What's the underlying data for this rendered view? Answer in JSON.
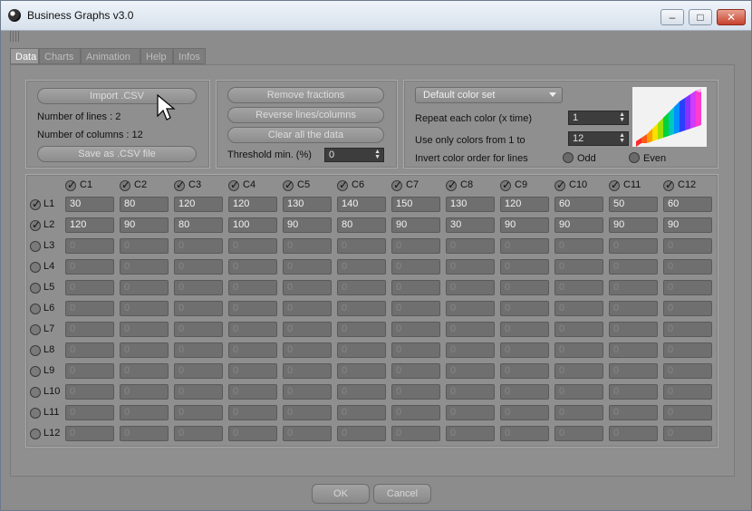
{
  "window": {
    "title": "Business Graphs v3.0",
    "min": "–",
    "max": "□",
    "close": "✕"
  },
  "tabs": [
    {
      "label": "Data",
      "active": true
    },
    {
      "label": "Charts",
      "active": false
    },
    {
      "label": "Animation",
      "active": false
    },
    {
      "label": "Help",
      "active": false
    },
    {
      "label": "Infos",
      "active": false
    }
  ],
  "import_panel": {
    "import_label": "Import .CSV",
    "lines_text": "Number of lines : 2",
    "columns_text": "Number of columns : 12",
    "save_label": "Save as .CSV file"
  },
  "ops_panel": {
    "remove_fractions": "Remove fractions",
    "reverse": "Reverse lines/columns",
    "clear": "Clear all the data",
    "threshold_label": "Threshold min. (%)",
    "threshold_value": "0"
  },
  "color_panel": {
    "color_set": "Default color set",
    "repeat_label": "Repeat each color (x time)",
    "repeat_value": "1",
    "only_colors_label": "Use only colors from 1 to",
    "only_colors_value": "12",
    "invert_label": "Invert color order for lines",
    "odd_label": "Odd",
    "even_label": "Even"
  },
  "grid": {
    "columns": [
      "C1",
      "C2",
      "C3",
      "C4",
      "C5",
      "C6",
      "C7",
      "C8",
      "C9",
      "C10",
      "C11",
      "C12"
    ],
    "rows": [
      {
        "label": "L1",
        "checked": true,
        "values": [
          "30",
          "80",
          "120",
          "120",
          "130",
          "140",
          "150",
          "130",
          "120",
          "60",
          "50",
          "60"
        ]
      },
      {
        "label": "L2",
        "checked": true,
        "values": [
          "120",
          "90",
          "80",
          "100",
          "90",
          "80",
          "90",
          "30",
          "90",
          "90",
          "90",
          "90"
        ]
      },
      {
        "label": "L3",
        "checked": false,
        "values": [
          "0",
          "0",
          "0",
          "0",
          "0",
          "0",
          "0",
          "0",
          "0",
          "0",
          "0",
          "0"
        ]
      },
      {
        "label": "L4",
        "checked": false,
        "values": [
          "0",
          "0",
          "0",
          "0",
          "0",
          "0",
          "0",
          "0",
          "0",
          "0",
          "0",
          "0"
        ]
      },
      {
        "label": "L5",
        "checked": false,
        "values": [
          "0",
          "0",
          "0",
          "0",
          "0",
          "0",
          "0",
          "0",
          "0",
          "0",
          "0",
          "0"
        ]
      },
      {
        "label": "L6",
        "checked": false,
        "values": [
          "0",
          "0",
          "0",
          "0",
          "0",
          "0",
          "0",
          "0",
          "0",
          "0",
          "0",
          "0"
        ]
      },
      {
        "label": "L7",
        "checked": false,
        "values": [
          "0",
          "0",
          "0",
          "0",
          "0",
          "0",
          "0",
          "0",
          "0",
          "0",
          "0",
          "0"
        ]
      },
      {
        "label": "L8",
        "checked": false,
        "values": [
          "0",
          "0",
          "0",
          "0",
          "0",
          "0",
          "0",
          "0",
          "0",
          "0",
          "0",
          "0"
        ]
      },
      {
        "label": "L9",
        "checked": false,
        "values": [
          "0",
          "0",
          "0",
          "0",
          "0",
          "0",
          "0",
          "0",
          "0",
          "0",
          "0",
          "0"
        ]
      },
      {
        "label": "L10",
        "checked": false,
        "values": [
          "0",
          "0",
          "0",
          "0",
          "0",
          "0",
          "0",
          "0",
          "0",
          "0",
          "0",
          "0"
        ]
      },
      {
        "label": "L11",
        "checked": false,
        "values": [
          "0",
          "0",
          "0",
          "0",
          "0",
          "0",
          "0",
          "0",
          "0",
          "0",
          "0",
          "0"
        ]
      },
      {
        "label": "L12",
        "checked": false,
        "values": [
          "0",
          "0",
          "0",
          "0",
          "0",
          "0",
          "0",
          "0",
          "0",
          "0",
          "0",
          "0"
        ]
      }
    ]
  },
  "footer": {
    "ok": "OK",
    "cancel": "Cancel"
  }
}
